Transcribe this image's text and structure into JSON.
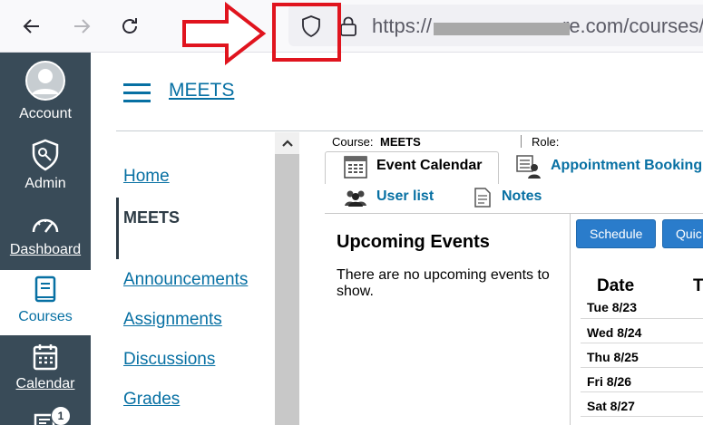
{
  "browser": {
    "url_prefix": "https://",
    "url_suffix": "re.com/courses/",
    "icons": {
      "back": "arrow-left-icon",
      "forward": "arrow-right-icon",
      "reload": "reload-icon",
      "shield": "shield-icon",
      "lock": "lock-icon"
    },
    "annotation_color": "#e0141e"
  },
  "global_nav": {
    "items": [
      {
        "label": "Account",
        "icon": "avatar-icon"
      },
      {
        "label": "Admin",
        "icon": "shield-key-icon"
      },
      {
        "label": "Dashboard",
        "icon": "gauge-icon"
      },
      {
        "label": "Courses",
        "icon": "book-icon"
      },
      {
        "label": "Calendar",
        "icon": "calendar-icon"
      },
      {
        "badge": "1",
        "icon": "inbox-icon"
      }
    ],
    "background": "#394b58"
  },
  "course": {
    "title": "MEETS",
    "nav": [
      "Home",
      "MEETS",
      "Announcements",
      "Assignments",
      "Discussions",
      "Grades"
    ],
    "accent": "#0770a3"
  },
  "tool": {
    "course_label": "Course:",
    "course_value": "MEETS",
    "role_label": "Role:",
    "tabs": [
      "Event Calendar",
      "Appointment Booking"
    ],
    "subtabs": [
      "User list",
      "Notes"
    ],
    "upcoming_title": "Upcoming Events",
    "upcoming_text": "There are no upcoming events to show.",
    "buttons": [
      "Schedule",
      "Quic"
    ],
    "date_header": "Date",
    "t_header": "T",
    "dates": [
      "Tue 8/23",
      "Wed 8/24",
      "Thu 8/25",
      "Fri 8/26",
      "Sat 8/27"
    ]
  }
}
